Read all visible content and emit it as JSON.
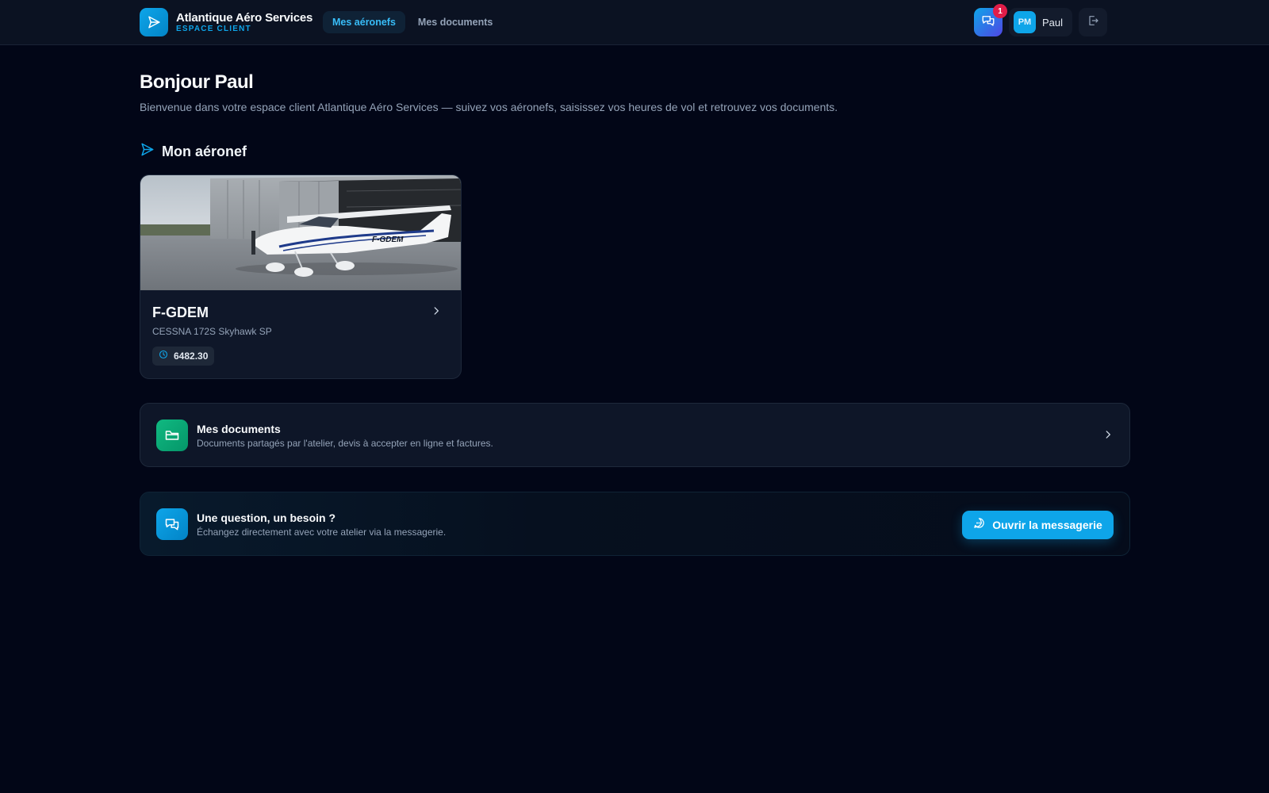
{
  "header": {
    "brand_name": "Atlantique Aéro Services",
    "brand_sub": "ESPACE CLIENT",
    "nav": [
      {
        "label": "Mes aéronefs",
        "active": true
      },
      {
        "label": "Mes documents",
        "active": false
      }
    ],
    "messages_badge": "1",
    "user_initials": "PM",
    "user_name": "Paul"
  },
  "main": {
    "greeting": "Bonjour Paul",
    "intro": "Bienvenue dans votre espace client Atlantique Aéro Services — suivez vos aéronefs, saisissez vos heures de vol et retrouvez vos documents.",
    "section_title": "Mon aéronef",
    "aircraft": {
      "registration": "F-GDEM",
      "model": "CESSNA 172S Skyhawk SP",
      "hours": "6482.30",
      "photo_registration": "F-GDEM"
    },
    "documents": {
      "title": "Mes documents",
      "description": "Documents partagés par l'atelier, devis à accepter en ligne et factures."
    },
    "help": {
      "title": "Une question, un besoin ?",
      "description": "Échangez directement avec votre atelier via la messagerie.",
      "button_label": "Ouvrir la messagerie"
    }
  },
  "icons": {
    "brand": "paper-plane-icon",
    "messages": "chat-bubbles-icon",
    "logout": "logout-icon",
    "section": "paper-plane-icon",
    "hours": "clock-icon",
    "documents": "folder-icon",
    "help": "chat-bubbles-icon",
    "open_button": "chat-dots-icon",
    "chevron": "chevron-right-icon"
  },
  "colors": {
    "background": "#020617",
    "accent": "#0ea5e9",
    "documents_accent": "#10b981",
    "badge": "#e11d48"
  }
}
